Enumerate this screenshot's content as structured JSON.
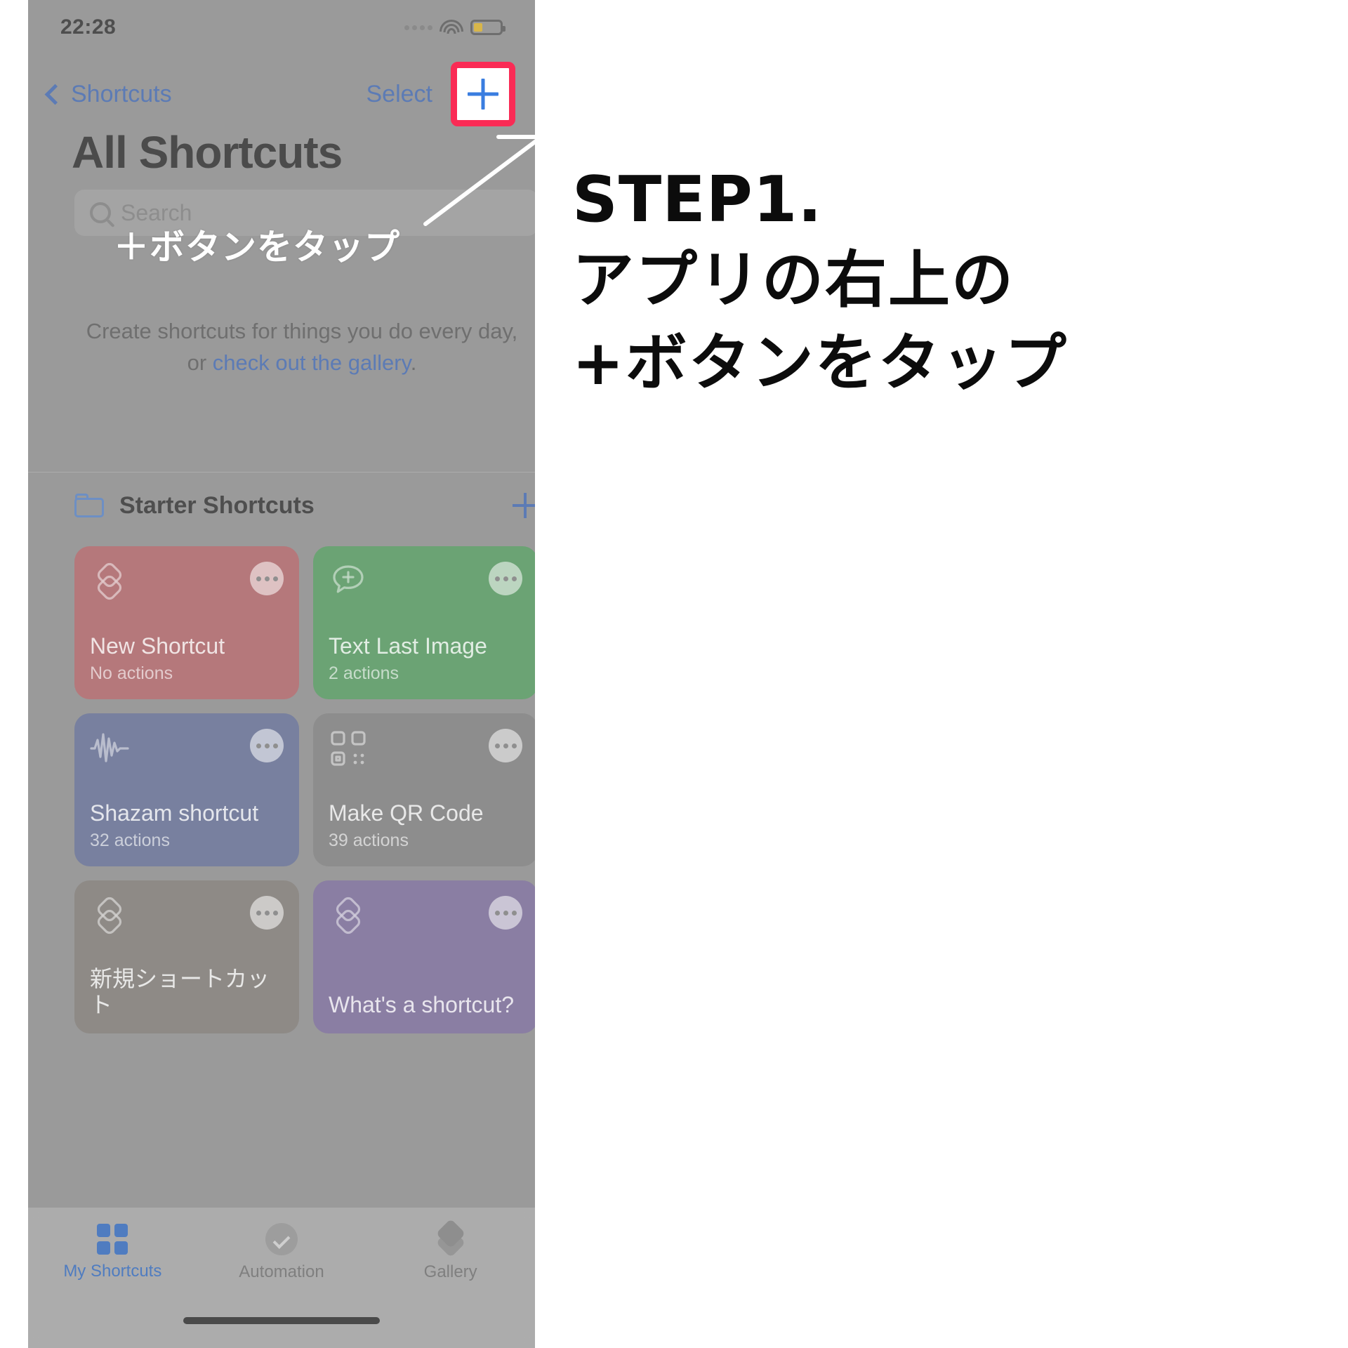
{
  "phone": {
    "status_bar": {
      "time": "22:28",
      "signal_icon": "cellular-signal-icon",
      "wifi_icon": "wifi-icon",
      "battery_icon": "battery-icon"
    },
    "nav_bar": {
      "back_label": "Shortcuts",
      "back_icon": "chevron-left-icon",
      "select_label": "Select",
      "add_icon": "plus-icon",
      "highlight_color": "#fa2b55"
    },
    "page_title": "All Shortcuts",
    "search": {
      "placeholder": "Search",
      "icon": "search-icon"
    },
    "empty_state": {
      "line1": "Create shortcuts for things you do every day,",
      "line2_prefix": "or ",
      "line2_link": "check out the gallery",
      "line2_suffix": "."
    },
    "folder": {
      "icon": "folder-icon",
      "name": "Starter Shortcuts",
      "add_icon": "plus-icon"
    },
    "cards": [
      {
        "title": "New Shortcut",
        "subtitle": "No actions",
        "color": "#b5787b",
        "glyph": "stacked-diamonds-icon",
        "menu_icon": "ellipsis-icon"
      },
      {
        "title": "Text Last Image",
        "subtitle": "2 actions",
        "color": "#6ba374",
        "glyph": "message-plus-icon",
        "menu_icon": "ellipsis-icon"
      },
      {
        "title": "Shazam shortcut",
        "subtitle": "32 actions",
        "color": "#78809f",
        "glyph": "waveform-icon",
        "menu_icon": "ellipsis-icon"
      },
      {
        "title": "Make QR Code",
        "subtitle": "39 actions",
        "color": "#8d8d8d",
        "glyph": "qr-code-icon",
        "menu_icon": "ellipsis-icon"
      },
      {
        "title": "新規ショートカット",
        "subtitle": "",
        "color": "#8e8a86",
        "glyph": "stacked-diamonds-icon",
        "menu_icon": "ellipsis-icon"
      },
      {
        "title": "What's a shortcut?",
        "subtitle": "",
        "color": "#8a7ea3",
        "glyph": "stacked-diamonds-icon",
        "menu_icon": "ellipsis-icon"
      }
    ],
    "tab_bar": {
      "tabs": [
        {
          "label": "My Shortcuts",
          "icon": "grid-squares-icon",
          "active": true
        },
        {
          "label": "Automation",
          "icon": "clock-check-icon",
          "active": false
        },
        {
          "label": "Gallery",
          "icon": "stacked-cards-icon",
          "active": false
        }
      ],
      "active_color": "#4f7cc0"
    },
    "annotation": {
      "overlay_text": "＋ボタンをタップ",
      "arrow_icon": "arrow-up-right-icon"
    }
  },
  "caption": {
    "step": "STEP1.",
    "line1": "アプリの右上の",
    "line2": "+ボタンをタップ"
  }
}
